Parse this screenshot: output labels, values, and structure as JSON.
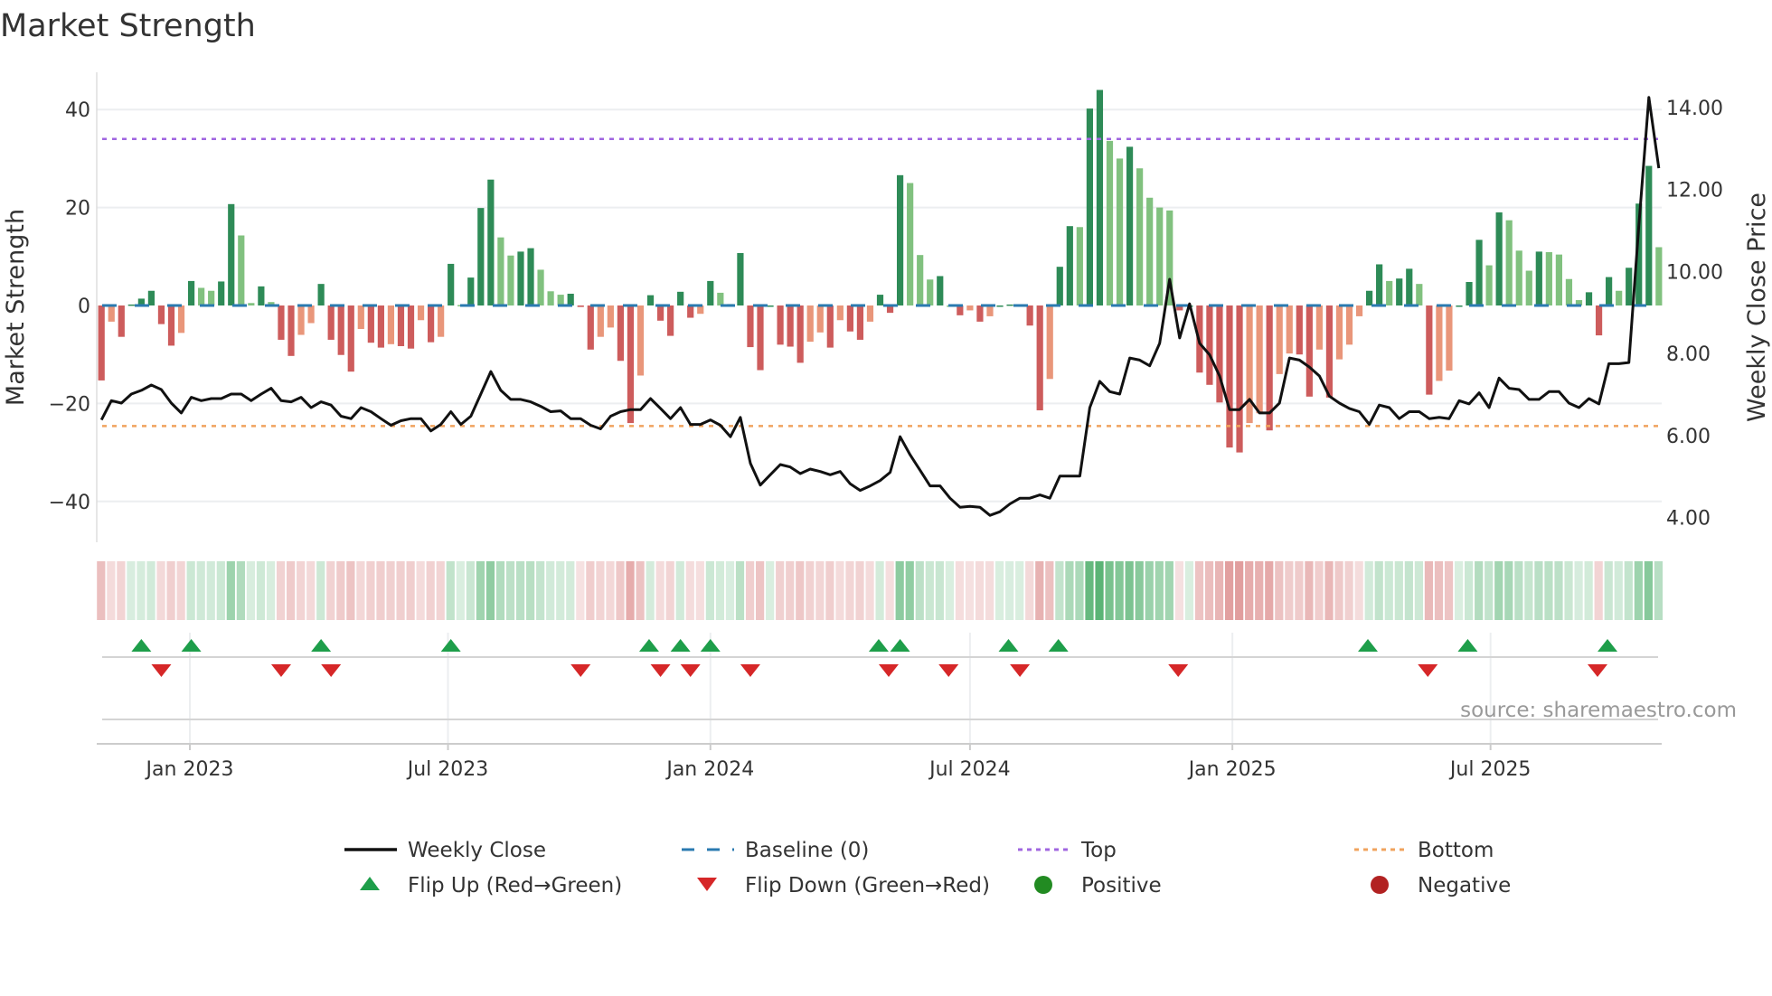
{
  "chart_data": {
    "type": "bar",
    "title": "Market Strength",
    "ylabel": "Market Strength",
    "y2label": "Weekly Close Price",
    "ylim": [
      -48,
      47
    ],
    "y2lim": [
      3.3,
      14.5
    ],
    "yticks": [
      {
        "v": 40,
        "label": "40"
      },
      {
        "v": 20,
        "label": "20"
      },
      {
        "v": 0,
        "label": "0"
      },
      {
        "v": -20,
        "label": "−20"
      },
      {
        "v": -40,
        "label": "−40"
      }
    ],
    "y2ticks": [
      {
        "v": 14,
        "label": "14.00"
      },
      {
        "v": 12,
        "label": "12.00"
      },
      {
        "v": 10,
        "label": "10.00"
      },
      {
        "v": 8,
        "label": "8.00"
      },
      {
        "v": 6,
        "label": "6.00"
      },
      {
        "v": 4,
        "label": "4.00"
      }
    ],
    "xticks": [
      {
        "date": "2023-01-01",
        "label": "Jan 2023"
      },
      {
        "date": "2023-07-01",
        "label": "Jul 2023"
      },
      {
        "date": "2024-01-01",
        "label": "Jan 2024"
      },
      {
        "date": "2024-07-01",
        "label": "Jul 2024"
      },
      {
        "date": "2025-01-01",
        "label": "Jan 2025"
      },
      {
        "date": "2025-07-01",
        "label": "Jul 2025"
      }
    ],
    "x_start": "2022-10-31",
    "x_step_days": 7,
    "top_level": 34,
    "bottom_level": -24.6,
    "strength": [
      -15.3,
      -3.3,
      -6.4,
      0.2,
      1.4,
      3,
      -3.8,
      -8.2,
      -5.6,
      5,
      3.6,
      3,
      4.9,
      20.7,
      14.3,
      0.5,
      3.9,
      0.7,
      -7,
      -10.3,
      -6,
      -3.6,
      4.4,
      -7,
      -10.1,
      -13.5,
      -4.8,
      -7.6,
      -8.6,
      -7.9,
      -8.3,
      -8.8,
      -3,
      -7.5,
      -6.4,
      8.5,
      0.1,
      5.7,
      19.9,
      25.7,
      13.9,
      10.2,
      11,
      11.7,
      7.3,
      2.9,
      2.2,
      2.4,
      -0.3,
      -9,
      -6.4,
      -4.5,
      -11.3,
      -24,
      -14.3,
      2.1,
      -3.1,
      -6.2,
      2.8,
      -2.5,
      -1.7,
      5,
      2.6,
      0.3,
      10.7,
      -8.5,
      -13.2,
      0,
      -8,
      -8.4,
      -11.7,
      -7.4,
      -5.5,
      -8.6,
      -3,
      -5.3,
      -7,
      -3.3,
      2.2,
      -1.5,
      26.6,
      25,
      10.3,
      5.3,
      6,
      0,
      -2,
      -1,
      -3.3,
      -2.2,
      0,
      0.2,
      0,
      -4.1,
      -21.4,
      -15,
      7.9,
      16.2,
      16,
      40.2,
      44,
      33.6,
      30,
      32.4,
      28,
      22,
      20,
      19.4,
      -1,
      0,
      -13.7,
      -16.2,
      -19.8,
      -29,
      -30,
      -24,
      -22,
      -25.5,
      -14,
      -9.8,
      -10,
      -18.6,
      -9,
      -18.8,
      -11,
      -8,
      -2.2,
      3,
      8.4,
      5,
      5.5,
      7.5,
      4.4,
      -18.2,
      -15.4,
      -13.3,
      0,
      4.8,
      13.4,
      8.2,
      19,
      17.4,
      11.2,
      7.1,
      11,
      10.9,
      10.4,
      5.4,
      1.1,
      2.7,
      -6.1,
      5.8,
      3,
      7.7,
      20.8,
      28.5,
      11.9
    ],
    "weekly_close": [
      6.38,
      6.85,
      6.79,
      7.01,
      7.1,
      7.23,
      7.12,
      6.79,
      6.55,
      6.93,
      6.85,
      6.9,
      6.9,
      7.01,
      7.01,
      6.85,
      7.01,
      7.15,
      6.85,
      6.82,
      6.93,
      6.68,
      6.82,
      6.74,
      6.47,
      6.41,
      6.68,
      6.58,
      6.41,
      6.25,
      6.36,
      6.41,
      6.41,
      6.11,
      6.27,
      6.58,
      6.27,
      6.47,
      7.01,
      7.56,
      7.1,
      6.88,
      6.88,
      6.82,
      6.71,
      6.58,
      6.6,
      6.41,
      6.41,
      6.25,
      6.16,
      6.47,
      6.58,
      6.63,
      6.63,
      6.9,
      6.66,
      6.41,
      6.68,
      6.27,
      6.27,
      6.38,
      6.25,
      5.97,
      6.44,
      5.32,
      4.79,
      5.04,
      5.29,
      5.23,
      5.07,
      5.18,
      5.12,
      5.04,
      5.12,
      4.82,
      4.66,
      4.77,
      4.9,
      5.1,
      5.97,
      5.53,
      5.15,
      4.77,
      4.77,
      4.47,
      4.25,
      4.27,
      4.25,
      4.05,
      4.14,
      4.33,
      4.47,
      4.47,
      4.55,
      4.47,
      5.01,
      5.01,
      5.01,
      6.68,
      7.32,
      7.07,
      7.01,
      7.89,
      7.84,
      7.7,
      8.25,
      9.81,
      8.38,
      9.21,
      8.25,
      7.97,
      7.45,
      6.63,
      6.63,
      6.88,
      6.55,
      6.55,
      6.79,
      7.89,
      7.84,
      7.67,
      7.45,
      6.96,
      6.79,
      6.66,
      6.58,
      6.27,
      6.74,
      6.68,
      6.41,
      6.58,
      6.58,
      6.41,
      6.44,
      6.41,
      6.85,
      6.77,
      7.04,
      6.68,
      7.4,
      7.15,
      7.12,
      6.88,
      6.88,
      7.07,
      7.07,
      6.79,
      6.68,
      6.9,
      6.77,
      7.75,
      7.75,
      7.78,
      11.12,
      14.25,
      12.52
    ],
    "flip_up_dates": [
      "2022-11-28",
      "2023-01-02",
      "2023-04-03",
      "2023-07-03",
      "2023-11-19",
      "2023-12-11",
      "2024-01-01",
      "2024-04-28",
      "2024-05-13",
      "2024-07-28",
      "2024-09-01",
      "2025-04-06",
      "2025-06-15",
      "2025-09-21"
    ],
    "flip_down_dates": [
      "2022-12-12",
      "2023-03-06",
      "2023-04-10",
      "2023-10-02",
      "2023-11-27",
      "2023-12-18",
      "2024-01-29",
      "2024-05-05",
      "2024-06-16",
      "2024-08-05",
      "2024-11-24",
      "2025-05-18",
      "2025-09-14"
    ],
    "legend": {
      "placement": "bottom",
      "items": [
        {
          "label": "Weekly Close",
          "kind": "line"
        },
        {
          "label": "Baseline (0)",
          "kind": "dash"
        },
        {
          "label": "Top",
          "kind": "dot-purple"
        },
        {
          "label": "Bottom",
          "kind": "dot-orange"
        },
        {
          "label": "Flip Up (Red→Green)",
          "kind": "tri-up"
        },
        {
          "label": "Flip Down (Green→Red)",
          "kind": "tri-down"
        },
        {
          "label": "Positive",
          "kind": "circle-green"
        },
        {
          "label": "Negative",
          "kind": "circle-red"
        }
      ]
    },
    "source": "source: sharemaestro.com",
    "colors": {
      "up_strong": "#2e8b57",
      "up_weak": "#81c17f",
      "down_strong": "#cd5c5c",
      "down_weak": "#e9967a",
      "line": "#111111",
      "baseline": "#2a7ab0",
      "top": "#a066e0",
      "bottom": "#f0a35e",
      "flip_up": "#1e9e4a",
      "flip_down": "#d62728",
      "positive": "#228b22",
      "negative": "#b22222",
      "grid": "#eceef0"
    }
  }
}
